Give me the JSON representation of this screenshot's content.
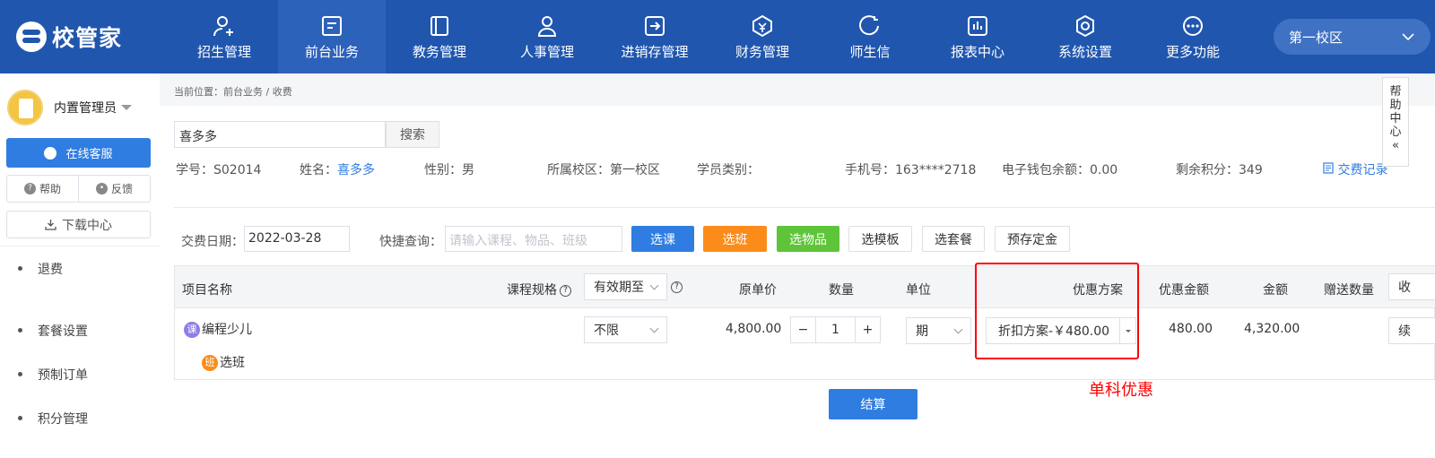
{
  "app": {
    "logo_text": "校管家"
  },
  "nav": [
    {
      "label": "招生管理",
      "icon": "user-plus-icon"
    },
    {
      "label": "前台业务",
      "icon": "front-desk-icon",
      "active": true
    },
    {
      "label": "教务管理",
      "icon": "book-icon"
    },
    {
      "label": "人事管理",
      "icon": "person-icon"
    },
    {
      "label": "进销存管理",
      "icon": "inventory-icon"
    },
    {
      "label": "财务管理",
      "icon": "finance-icon"
    },
    {
      "label": "师生信",
      "icon": "message-icon"
    },
    {
      "label": "报表中心",
      "icon": "report-icon"
    },
    {
      "label": "系统设置",
      "icon": "settings-icon"
    },
    {
      "label": "更多功能",
      "icon": "more-icon"
    }
  ],
  "campus_select": {
    "value": "第一校区"
  },
  "sidebar": {
    "user_name": "内置管理员",
    "service_btn": "在线客服",
    "help": "帮助",
    "feedback": "反馈",
    "download": "下载中心",
    "menu": [
      "退费",
      "套餐设置",
      "预制订单",
      "积分管理"
    ]
  },
  "breadcrumb": "当前位置：前台业务 / 收费",
  "search": {
    "value": "喜多多",
    "button": "搜索"
  },
  "student": {
    "id_label": "学号：",
    "id": "S02014",
    "name_label": "姓名：",
    "name": "喜多多",
    "gender": "性别：男",
    "campus": "所属校区：第一校区",
    "type": "学员类别：",
    "phone": "手机号：163****2718",
    "wallet": "电子钱包余额：0.00",
    "points": "剩余积分：349",
    "records": "交费记录"
  },
  "toolbar": {
    "date_label": "交费日期：",
    "date_value": "2022-03-28",
    "quick_label": "快捷查询：",
    "quick_placeholder": "请输入课程、物品、班级",
    "buttons": [
      "选课",
      "选班",
      "选物品",
      "选模板",
      "选套餐",
      "预存定金"
    ]
  },
  "table": {
    "headers": {
      "item": "项目名称",
      "spec": "课程规格",
      "validity": "有效期至",
      "price": "原单价",
      "qty": "数量",
      "unit": "单位",
      "plan": "优惠方案",
      "discount": "优惠金额",
      "amount": "金额",
      "gift": "赠送数量",
      "extra": "收"
    },
    "row": {
      "course_badge": "课",
      "course_name": "编程少儿",
      "class_badge": "班",
      "class_action": "选班",
      "validity": "不限",
      "price": "4,800.00",
      "qty": "1",
      "minus": "−",
      "plus": "+",
      "unit": "期",
      "plan": "折扣方案-￥480.00",
      "discount": "480.00",
      "amount": "4,320.00",
      "extra": "续"
    }
  },
  "annotation": "单科优惠",
  "settle_btn": "结算",
  "help_center": [
    "帮",
    "助",
    "中",
    "心",
    "«"
  ],
  "colors": {
    "brand": "#2056ae",
    "primary": "#2f7de1",
    "orange": "#fb8c1a",
    "green": "#5ec439",
    "annotation": "#ff0000"
  }
}
